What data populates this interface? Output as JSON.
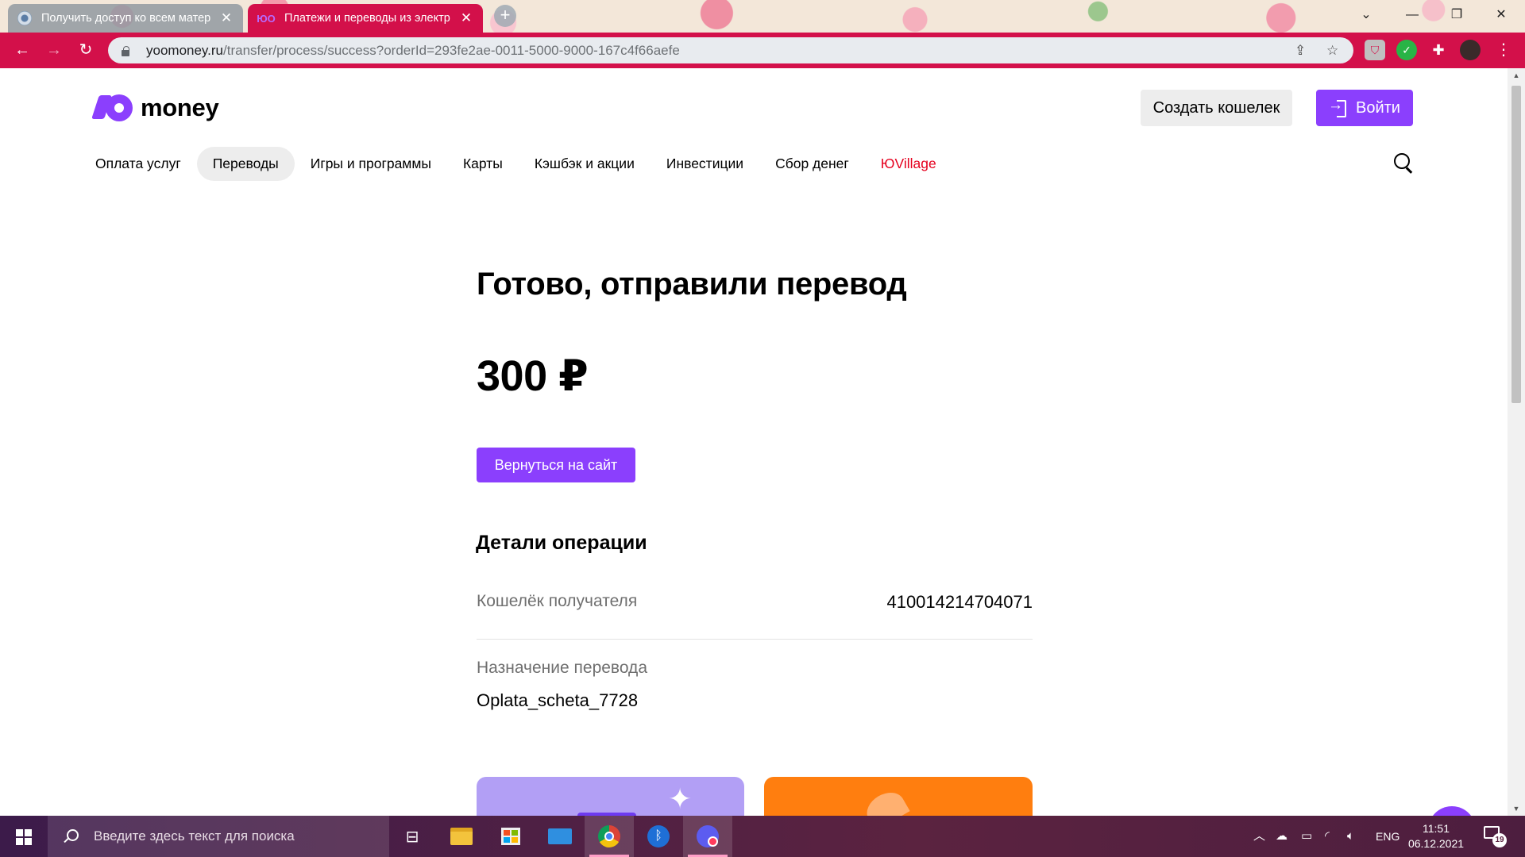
{
  "browser": {
    "tabs": [
      {
        "title": "Получить доступ ко всем матер",
        "active": false
      },
      {
        "title": "Платежи и переводы из электр",
        "active": true
      }
    ],
    "url_host": "yoomoney.ru",
    "url_path": "/transfer/process/success?orderId=293fe2ae-0011-5000-9000-167c4f66aefe"
  },
  "header": {
    "logo_text": "money",
    "create_wallet": "Создать кошелек",
    "login": "Войти"
  },
  "nav": {
    "items": [
      "Оплата услуг",
      "Переводы",
      "Игры и программы",
      "Карты",
      "Кэшбэк и акции",
      "Инвестиции",
      "Сбор денег",
      "ЮVillage"
    ],
    "active_index": 1
  },
  "main": {
    "headline": "Готово, отправили перевод",
    "amount": "300 ₽",
    "back_button": "Вернуться на сайт",
    "details_title": "Детали операции",
    "recipient_label": "Кошелёк получателя",
    "recipient_value": "410014214704071",
    "purpose_label": "Назначение перевода",
    "purpose_value": "Oplata_scheta_7728"
  },
  "help_label": "?",
  "taskbar": {
    "search_placeholder": "Введите здесь текст для поиска",
    "lang": "ENG",
    "time": "11:51",
    "date": "06.12.2021",
    "notifications": "19"
  },
  "colors": {
    "brand": "#8b3ffd",
    "browser_frame": "#d3104a",
    "nav_accent": "#e5001e",
    "promo_lilac": "#b29ff5",
    "promo_orange": "#ff7e0f"
  }
}
